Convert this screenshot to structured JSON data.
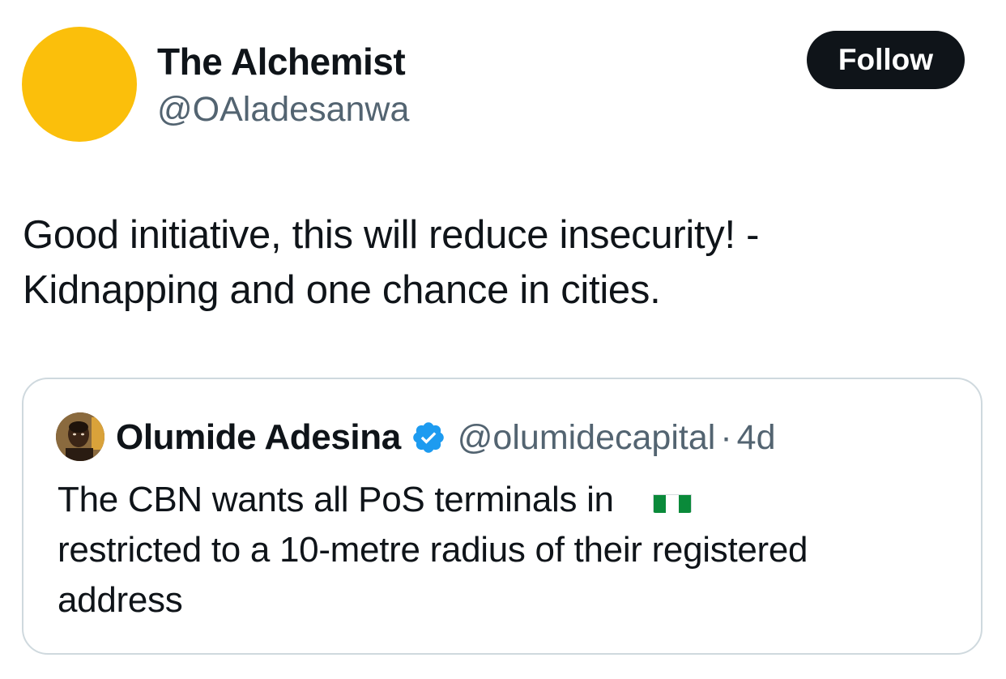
{
  "author": {
    "display_name": "The Alchemist",
    "handle": "@OAladesanwa",
    "avatar_color": "#fbbf0b",
    "avatar_icon": "yellow-circle-avatar"
  },
  "follow_button": {
    "label": "Follow"
  },
  "tweet": {
    "line1": "Good initiative, this will reduce insecurity! -",
    "line2": "Kidnapping and one chance in cities."
  },
  "quoted_tweet": {
    "author_name": "Olumide Adesina",
    "verified": true,
    "verified_icon": "blue-verified-badge-icon",
    "handle": "@olumidecapital",
    "separator": "·",
    "time": "4d",
    "text_line1": "The CBN wants all PoS terminals in",
    "flag_icon": "nigeria-flag-icon",
    "text_line2": "restricted to a 10-metre radius of their registered",
    "text_line3": "address"
  },
  "colors": {
    "text_primary": "#0f1419",
    "text_secondary": "#536471",
    "verified_blue": "#1d9bf0",
    "border": "#cfd9de",
    "follow_bg": "#0f1419"
  }
}
